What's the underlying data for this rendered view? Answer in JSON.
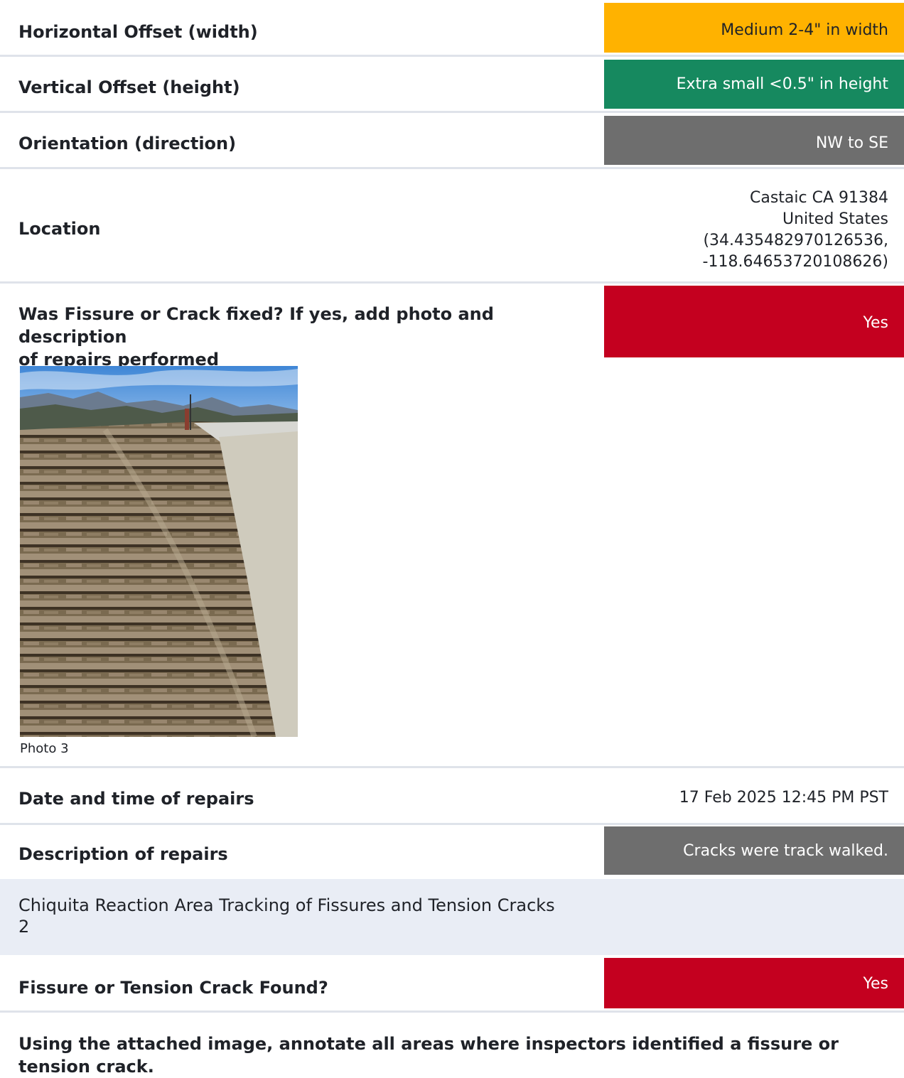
{
  "rows": {
    "horizontal_offset": {
      "label": "Horizontal Offset (width)",
      "value": "Medium 2-4\" in width",
      "color": "#ffb200"
    },
    "vertical_offset": {
      "label": "Vertical Offset (height)",
      "value": "Extra small <0.5\" in height",
      "color": "#16895f"
    },
    "orientation": {
      "label": "Orientation (direction)",
      "value": "NW to SE",
      "color": "#6e6e6e"
    },
    "location": {
      "label": "Location",
      "lines": [
        "Castaic CA 91384",
        "United States",
        "(34.435482970126536,",
        "-118.64653720108626)"
      ]
    },
    "fixed": {
      "label_line1": "Was Fissure or Crack fixed? If yes, add photo and description",
      "label_line2": "of repairs performed",
      "value": "Yes",
      "color": "#c4001f"
    },
    "photo": {
      "caption": "Photo 3"
    },
    "repair_date": {
      "label": "Date and time of repairs",
      "value": "17 Feb 2025 12:45 PM PST"
    },
    "repair_description": {
      "label": "Description of repairs",
      "value": "Cracks were track walked.",
      "color": "#6e6e6e"
    }
  },
  "section": {
    "title_line1": "Chiquita Reaction Area Tracking of Fissures and Tension Cracks",
    "title_line2": "2"
  },
  "found": {
    "label": "Fissure or Tension Crack Found?",
    "value": "Yes",
    "color": "#c4001f"
  },
  "annotate_prompt": {
    "line1": "Using the attached image, annotate all areas where inspectors identified a fissure or",
    "line2": "tension crack."
  }
}
